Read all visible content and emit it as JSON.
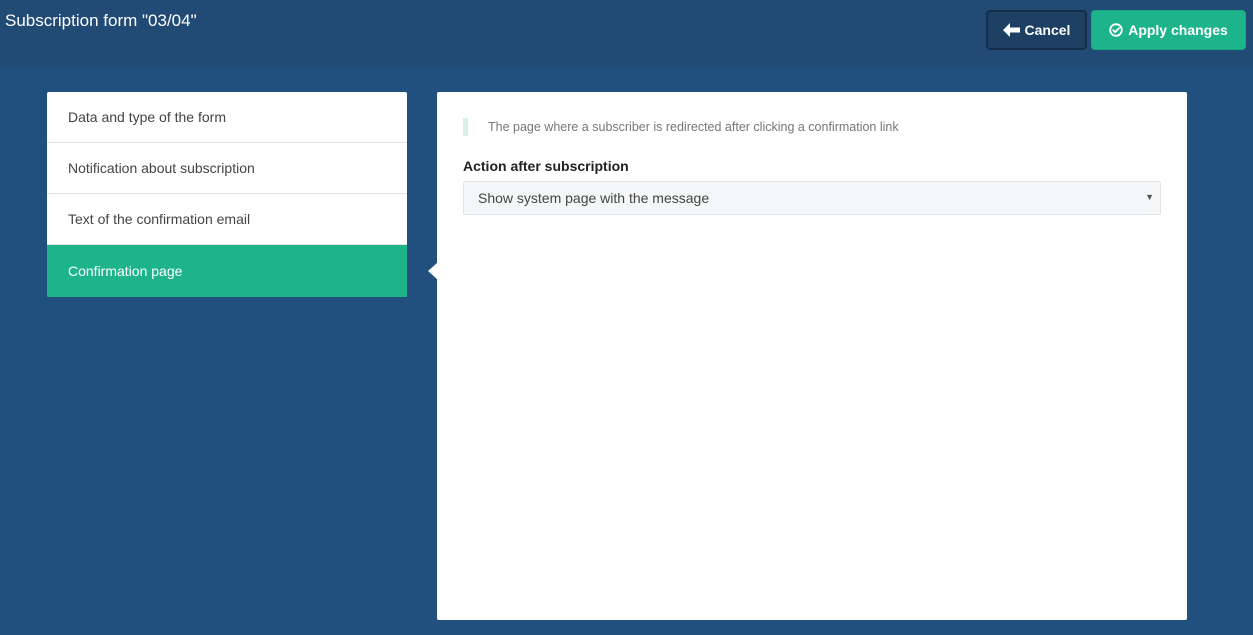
{
  "header": {
    "title": "Subscription form \"03/04\"",
    "cancel_label": "Cancel",
    "apply_label": "Apply changes"
  },
  "sidebar": {
    "items": [
      {
        "label": "Data and type of the form",
        "active": false
      },
      {
        "label": "Notification about subscription",
        "active": false
      },
      {
        "label": "Text of the confirmation email",
        "active": false
      },
      {
        "label": "Confirmation page",
        "active": true
      }
    ]
  },
  "panel": {
    "hint": "The page where a subscriber is redirected after clicking a confirmation link",
    "action_label": "Action after subscription",
    "action_select": {
      "value": "Show system page with the message"
    }
  },
  "icons": {
    "cancel": "arrow-left-icon",
    "apply": "check-circle-icon",
    "select": "caret-down-icon"
  },
  "colors": {
    "background": "#22507e",
    "topbar": "#214a75",
    "accent": "#1db48c",
    "cancel_button": "#1c3f63"
  }
}
